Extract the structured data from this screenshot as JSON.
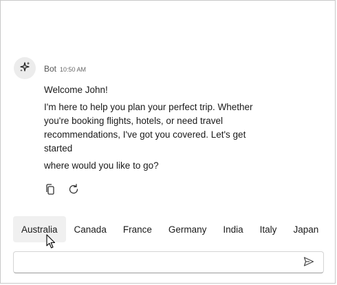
{
  "message": {
    "sender": "Bot",
    "timestamp": "10:50 AM",
    "welcome": "Welcome John!",
    "body": "I'm here to help you plan your perfect trip. Whether you're booking flights, hotels, or need travel recommendations, I've got you covered. Let's get started",
    "question": "where would you like to go?"
  },
  "actions": {
    "copy_icon": "copy-icon",
    "regenerate_icon": "refresh-icon"
  },
  "suggestions": [
    "Australia",
    "Canada",
    "France",
    "Germany",
    "India",
    "Italy",
    "Japan"
  ],
  "composer": {
    "value": "",
    "placeholder": "",
    "send_icon": "send-icon"
  },
  "avatar_icon": "sparkle-icon",
  "colors": {
    "avatar_bg": "#ececec",
    "hover_bg": "#f0f0f0",
    "text": "#1a1a1a",
    "muted": "#555555"
  }
}
